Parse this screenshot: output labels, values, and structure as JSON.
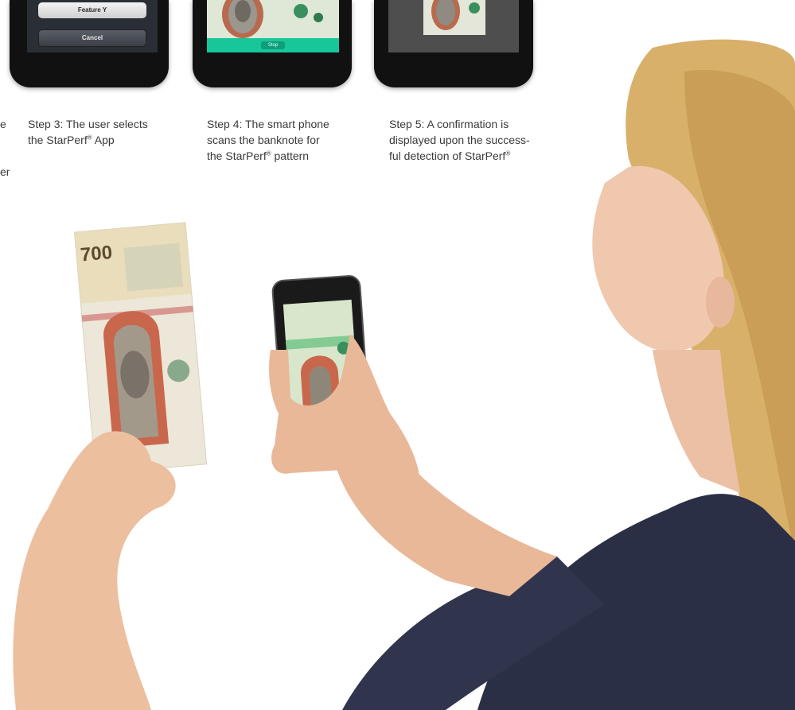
{
  "step3": {
    "menu": {
      "feature_y": "Feature Y",
      "cancel": "Cancel"
    },
    "caption": {
      "line1": "Step 3: The user selects",
      "line2_pre": "the StarPerf",
      "line2_post": " App"
    }
  },
  "step4": {
    "screen_button": "Stop",
    "caption": {
      "line1": "Step 4: The smart phone",
      "line2": "scans the banknote for",
      "line3_pre": "the StarPerf",
      "line3_post": " pattern"
    }
  },
  "step5": {
    "caption": {
      "line1": "Step 5: A confirmation is",
      "line2": "displayed upon the success-",
      "line3_pre": "ful detection of StarPerf"
    }
  },
  "cutoff_text": {
    "line1": "e",
    "line2": "er"
  },
  "registered_mark": "®",
  "banknote": {
    "denomination": "700"
  },
  "colors": {
    "accent_green": "#17c79a",
    "caption_text": "#3a3a3a",
    "jacket": "#2b2f45",
    "hair": "#d8b06a"
  },
  "icons": [
    "banknote-image",
    "smartphone-image",
    "woman-image",
    "hand-image"
  ]
}
